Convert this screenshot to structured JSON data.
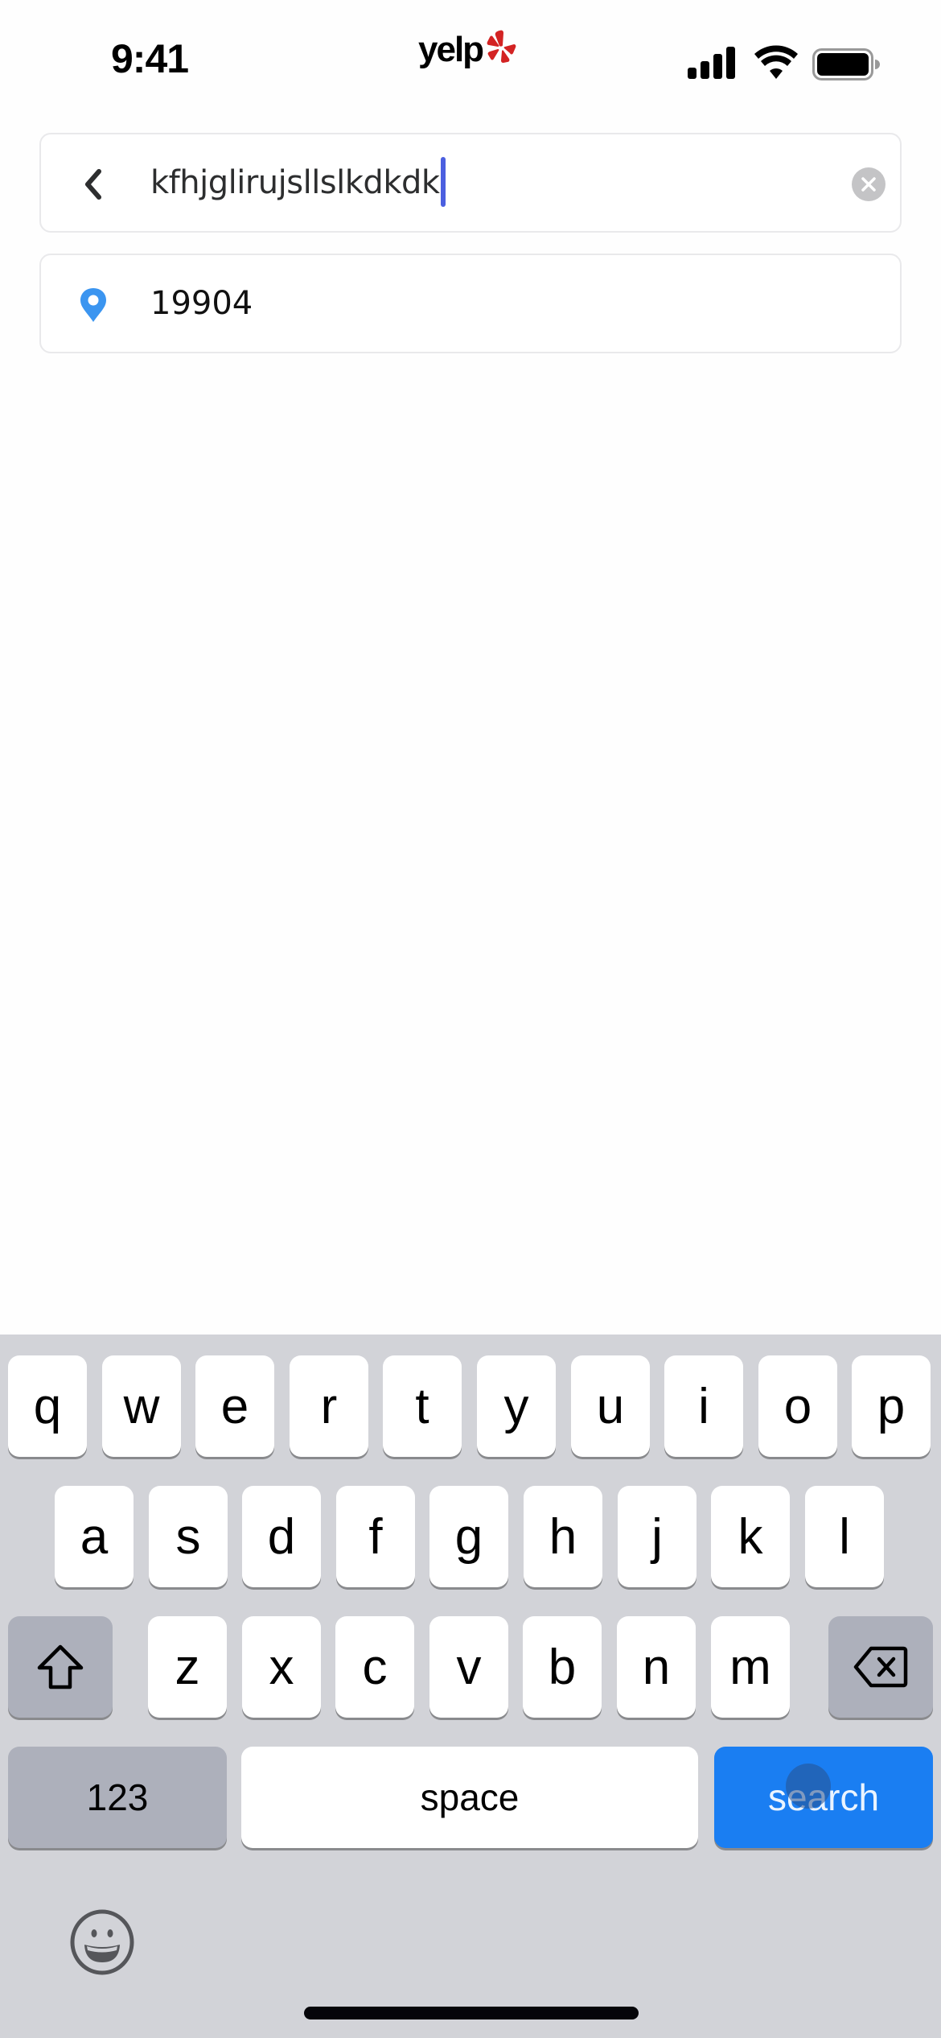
{
  "status_bar": {
    "time": "9:41",
    "app_logo": "yelp",
    "icons": [
      "cellular-signal-icon",
      "wifi-icon",
      "battery-icon"
    ]
  },
  "search_field": {
    "value": "kfhjglirujsllslkdkdk",
    "leading_icon": "back-chevron-icon",
    "trailing_icon": "clear-icon"
  },
  "location_field": {
    "value": "19904",
    "leading_icon": "location-pin-icon"
  },
  "colors": {
    "brand_red": "#d32323",
    "pin_blue": "#3b95f0",
    "caret": "#4b5fe0",
    "search_key": "#1a7ef2"
  },
  "keyboard": {
    "row1": [
      "q",
      "w",
      "e",
      "r",
      "t",
      "y",
      "u",
      "i",
      "o",
      "p"
    ],
    "row2": [
      "a",
      "s",
      "d",
      "f",
      "g",
      "h",
      "j",
      "k",
      "l"
    ],
    "row3": [
      "z",
      "x",
      "c",
      "v",
      "b",
      "n",
      "m"
    ],
    "shift_icon": "shift-icon",
    "delete_icon": "backspace-icon",
    "numbers_label": "123",
    "space_label": "space",
    "return_label": "search",
    "emoji_icon": "emoji-icon"
  }
}
